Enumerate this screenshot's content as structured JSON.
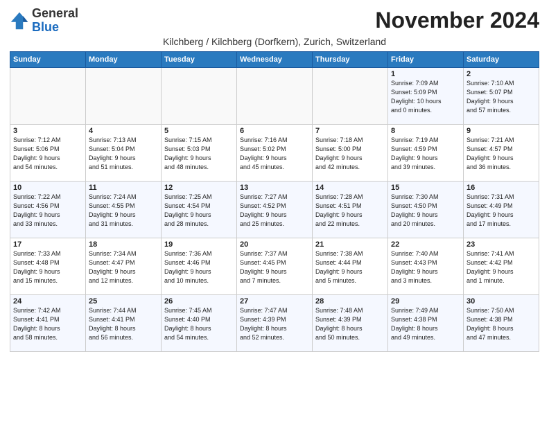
{
  "logo": {
    "general": "General",
    "blue": "Blue"
  },
  "title": "November 2024",
  "subtitle": "Kilchberg / Kilchberg (Dorfkern), Zurich, Switzerland",
  "days_of_week": [
    "Sunday",
    "Monday",
    "Tuesday",
    "Wednesday",
    "Thursday",
    "Friday",
    "Saturday"
  ],
  "weeks": [
    [
      {
        "day": "",
        "info": ""
      },
      {
        "day": "",
        "info": ""
      },
      {
        "day": "",
        "info": ""
      },
      {
        "day": "",
        "info": ""
      },
      {
        "day": "",
        "info": ""
      },
      {
        "day": "1",
        "info": "Sunrise: 7:09 AM\nSunset: 5:09 PM\nDaylight: 10 hours\nand 0 minutes."
      },
      {
        "day": "2",
        "info": "Sunrise: 7:10 AM\nSunset: 5:07 PM\nDaylight: 9 hours\nand 57 minutes."
      }
    ],
    [
      {
        "day": "3",
        "info": "Sunrise: 7:12 AM\nSunset: 5:06 PM\nDaylight: 9 hours\nand 54 minutes."
      },
      {
        "day": "4",
        "info": "Sunrise: 7:13 AM\nSunset: 5:04 PM\nDaylight: 9 hours\nand 51 minutes."
      },
      {
        "day": "5",
        "info": "Sunrise: 7:15 AM\nSunset: 5:03 PM\nDaylight: 9 hours\nand 48 minutes."
      },
      {
        "day": "6",
        "info": "Sunrise: 7:16 AM\nSunset: 5:02 PM\nDaylight: 9 hours\nand 45 minutes."
      },
      {
        "day": "7",
        "info": "Sunrise: 7:18 AM\nSunset: 5:00 PM\nDaylight: 9 hours\nand 42 minutes."
      },
      {
        "day": "8",
        "info": "Sunrise: 7:19 AM\nSunset: 4:59 PM\nDaylight: 9 hours\nand 39 minutes."
      },
      {
        "day": "9",
        "info": "Sunrise: 7:21 AM\nSunset: 4:57 PM\nDaylight: 9 hours\nand 36 minutes."
      }
    ],
    [
      {
        "day": "10",
        "info": "Sunrise: 7:22 AM\nSunset: 4:56 PM\nDaylight: 9 hours\nand 33 minutes."
      },
      {
        "day": "11",
        "info": "Sunrise: 7:24 AM\nSunset: 4:55 PM\nDaylight: 9 hours\nand 31 minutes."
      },
      {
        "day": "12",
        "info": "Sunrise: 7:25 AM\nSunset: 4:54 PM\nDaylight: 9 hours\nand 28 minutes."
      },
      {
        "day": "13",
        "info": "Sunrise: 7:27 AM\nSunset: 4:52 PM\nDaylight: 9 hours\nand 25 minutes."
      },
      {
        "day": "14",
        "info": "Sunrise: 7:28 AM\nSunset: 4:51 PM\nDaylight: 9 hours\nand 22 minutes."
      },
      {
        "day": "15",
        "info": "Sunrise: 7:30 AM\nSunset: 4:50 PM\nDaylight: 9 hours\nand 20 minutes."
      },
      {
        "day": "16",
        "info": "Sunrise: 7:31 AM\nSunset: 4:49 PM\nDaylight: 9 hours\nand 17 minutes."
      }
    ],
    [
      {
        "day": "17",
        "info": "Sunrise: 7:33 AM\nSunset: 4:48 PM\nDaylight: 9 hours\nand 15 minutes."
      },
      {
        "day": "18",
        "info": "Sunrise: 7:34 AM\nSunset: 4:47 PM\nDaylight: 9 hours\nand 12 minutes."
      },
      {
        "day": "19",
        "info": "Sunrise: 7:36 AM\nSunset: 4:46 PM\nDaylight: 9 hours\nand 10 minutes."
      },
      {
        "day": "20",
        "info": "Sunrise: 7:37 AM\nSunset: 4:45 PM\nDaylight: 9 hours\nand 7 minutes."
      },
      {
        "day": "21",
        "info": "Sunrise: 7:38 AM\nSunset: 4:44 PM\nDaylight: 9 hours\nand 5 minutes."
      },
      {
        "day": "22",
        "info": "Sunrise: 7:40 AM\nSunset: 4:43 PM\nDaylight: 9 hours\nand 3 minutes."
      },
      {
        "day": "23",
        "info": "Sunrise: 7:41 AM\nSunset: 4:42 PM\nDaylight: 9 hours\nand 1 minute."
      }
    ],
    [
      {
        "day": "24",
        "info": "Sunrise: 7:42 AM\nSunset: 4:41 PM\nDaylight: 8 hours\nand 58 minutes."
      },
      {
        "day": "25",
        "info": "Sunrise: 7:44 AM\nSunset: 4:41 PM\nDaylight: 8 hours\nand 56 minutes."
      },
      {
        "day": "26",
        "info": "Sunrise: 7:45 AM\nSunset: 4:40 PM\nDaylight: 8 hours\nand 54 minutes."
      },
      {
        "day": "27",
        "info": "Sunrise: 7:47 AM\nSunset: 4:39 PM\nDaylight: 8 hours\nand 52 minutes."
      },
      {
        "day": "28",
        "info": "Sunrise: 7:48 AM\nSunset: 4:39 PM\nDaylight: 8 hours\nand 50 minutes."
      },
      {
        "day": "29",
        "info": "Sunrise: 7:49 AM\nSunset: 4:38 PM\nDaylight: 8 hours\nand 49 minutes."
      },
      {
        "day": "30",
        "info": "Sunrise: 7:50 AM\nSunset: 4:38 PM\nDaylight: 8 hours\nand 47 minutes."
      }
    ]
  ]
}
